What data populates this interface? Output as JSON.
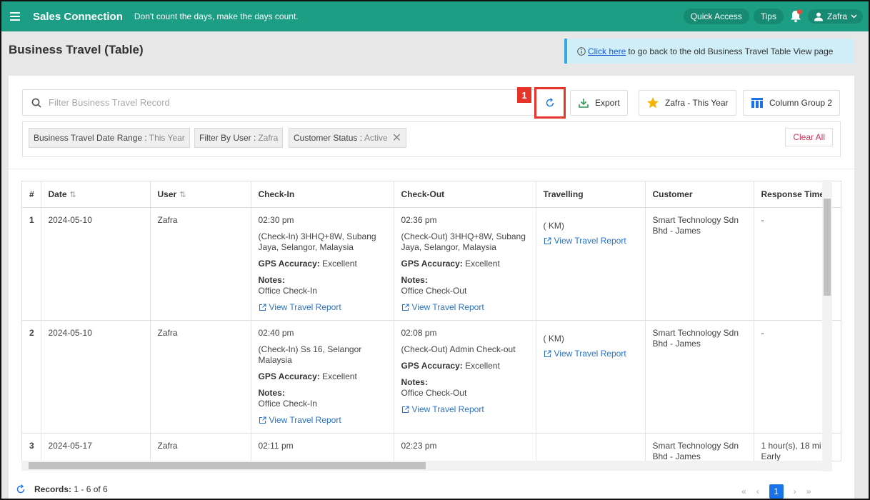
{
  "topbar": {
    "brand": "Sales Connection",
    "tagline": "Don't count the days, make the days count.",
    "quick_access": "Quick Access",
    "tips": "Tips",
    "user_name": "Zafra"
  },
  "header": {
    "title": "Business Travel (Table)",
    "banner_link": "Click here",
    "banner_text": "to go back to the old Business Travel Table View page"
  },
  "toolbar": {
    "search_placeholder": "Filter Business Travel Record",
    "step_number": "1",
    "export_label": "Export",
    "preset_label": "Zafra - This Year",
    "column_group_label": "Column Group 2"
  },
  "filters": {
    "chips": [
      {
        "label": "Business Travel Date Range :",
        "value": "This Year"
      },
      {
        "label": "Filter By User :",
        "value": "Zafra"
      },
      {
        "label": "Customer Status :",
        "value": "Active"
      }
    ],
    "clear_all": "Clear All"
  },
  "table": {
    "columns": [
      "#",
      "Date",
      "User",
      "Check-In",
      "Check-Out",
      "Travelling",
      "Customer",
      "Response Time"
    ],
    "rows": [
      {
        "num": "1",
        "date": "2024-05-10",
        "user": "Zafra",
        "checkin_time": "02:30 pm",
        "checkin_addr": "(Check-In) 3HHQ+8W, Subang Jaya, Selangor, Malaysia",
        "checkin_gps_label": "GPS Accuracy:",
        "checkin_gps": "Excellent",
        "checkin_notes_label": "Notes:",
        "checkin_notes": "Office Check-In",
        "checkin_report": "View Travel Report",
        "checkout_time": "02:36 pm",
        "checkout_addr": "(Check-Out) 3HHQ+8W, Subang Jaya, Selangor, Malaysia",
        "checkout_gps_label": "GPS Accuracy:",
        "checkout_gps": "Excellent",
        "checkout_notes_label": "Notes:",
        "checkout_notes": "Office Check-Out",
        "checkout_report": "View Travel Report",
        "travel_km": "( KM)",
        "travel_report": "View Travel Report",
        "customer": "Smart Technology Sdn Bhd - James",
        "response": "-"
      },
      {
        "num": "2",
        "date": "2024-05-10",
        "user": "Zafra",
        "checkin_time": "02:40 pm",
        "checkin_addr": "(Check-In) Ss 16, Selangor Malaysia",
        "checkin_gps_label": "GPS Accuracy:",
        "checkin_gps": "Excellent",
        "checkin_notes_label": "Notes:",
        "checkin_notes": "Office Check-In",
        "checkin_report": "View Travel Report",
        "checkout_time": "02:08 pm",
        "checkout_addr": "(Check-Out) Admin Check-out",
        "checkout_gps_label": "GPS Accuracy:",
        "checkout_gps": "Excellent",
        "checkout_notes_label": "Notes:",
        "checkout_notes": "Office Check-Out",
        "checkout_report": "View Travel Report",
        "travel_km": "( KM)",
        "travel_report": "View Travel Report",
        "customer": "Smart Technology Sdn Bhd - James",
        "response": "-"
      },
      {
        "num": "3",
        "date": "2024-05-17",
        "user": "Zafra",
        "checkin_time": "02:11 pm",
        "checkout_time": "02:23 pm",
        "customer": "Smart Technology Sdn Bhd - James",
        "response": "1 hour(s), 18 mi",
        "response_sub": "Early"
      }
    ]
  },
  "footer": {
    "records_label": "Records:",
    "records_value": "1 - 6  of  6",
    "current_page": "1"
  },
  "colors": {
    "topbar": "#1b9e84",
    "highlight": "#e5352b",
    "link": "#2a73c9"
  }
}
